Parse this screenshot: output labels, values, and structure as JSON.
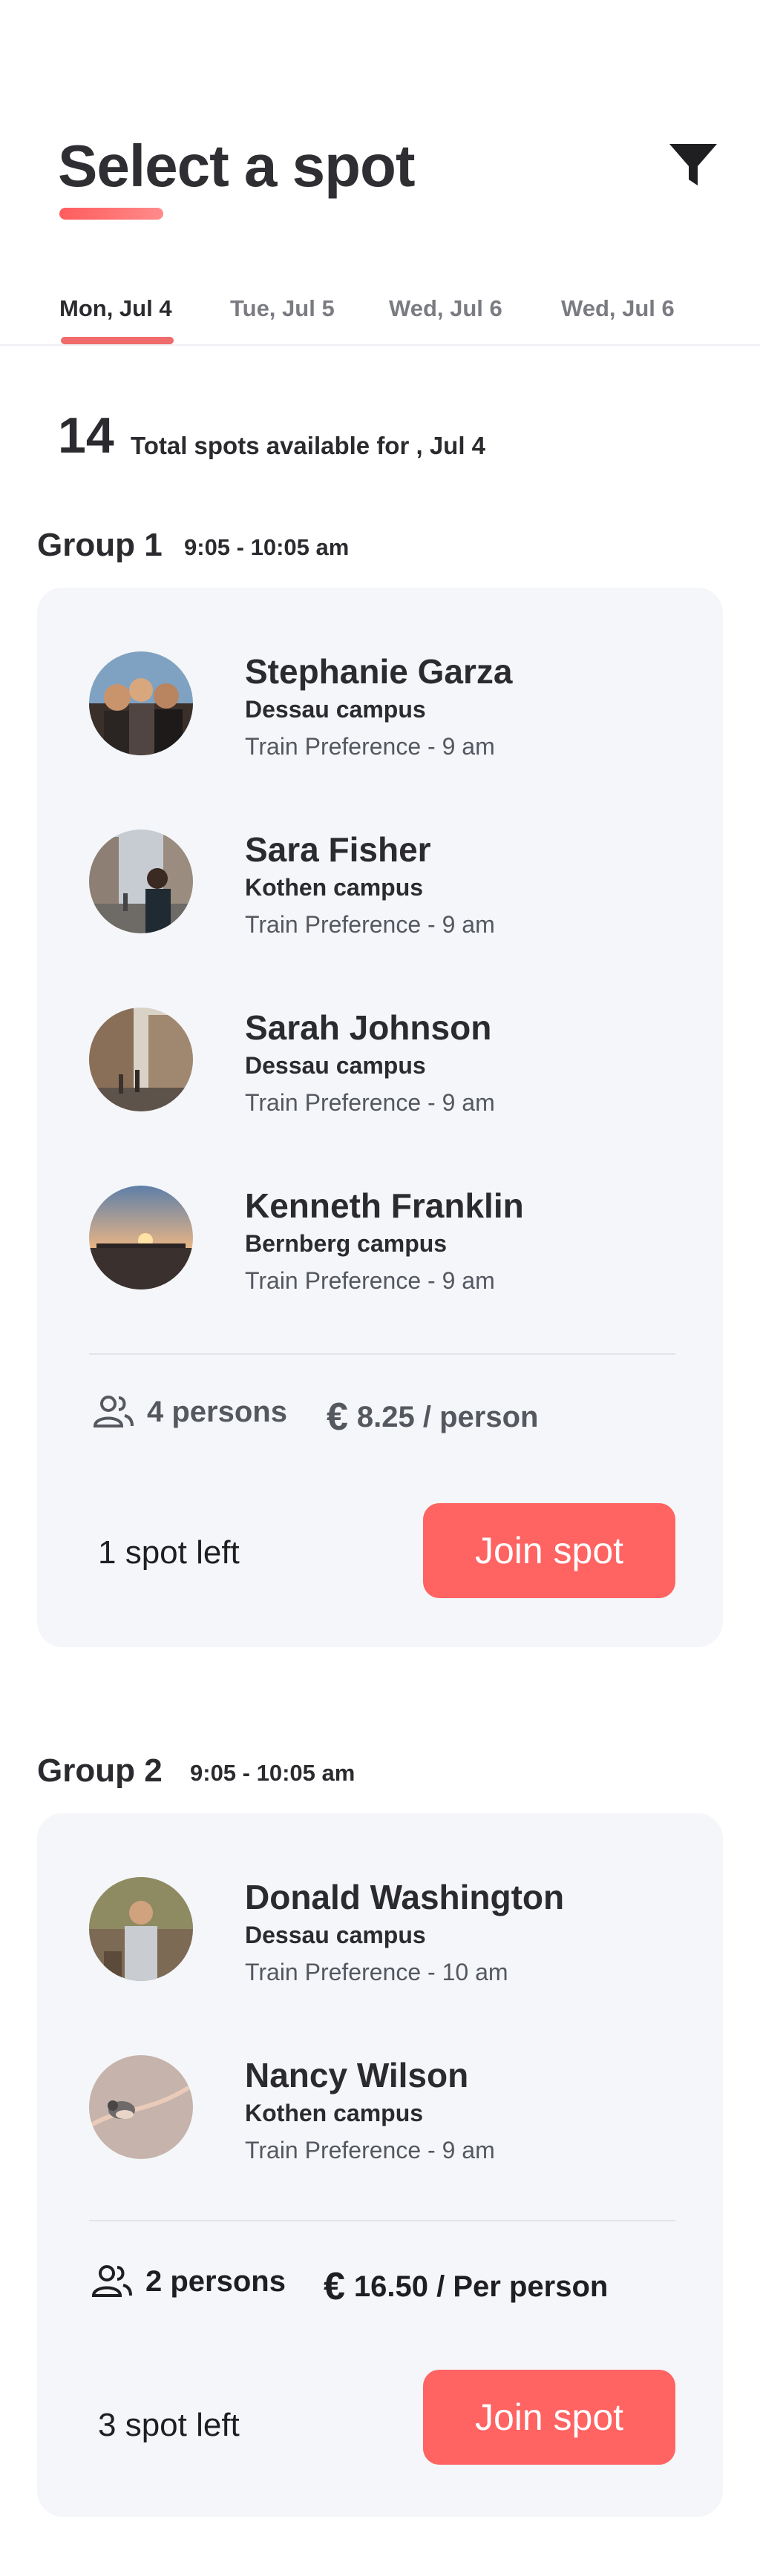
{
  "header": {
    "title": "Select a spot",
    "filter_icon": "filter-funnel-icon",
    "accent_color": "#ff6362"
  },
  "tabs": [
    {
      "label": "Mon, Jul 4",
      "active": true
    },
    {
      "label": "Tue, Jul 5",
      "active": false
    },
    {
      "label": "Wed, Jul 6",
      "active": false
    },
    {
      "label": "Wed, Jul 6",
      "active": false
    }
  ],
  "summary": {
    "total": "14",
    "label": "Total spots available for , Jul 4"
  },
  "groups": [
    {
      "title": "Group 1",
      "time": "9:05 - 10:05 am",
      "members": [
        {
          "name": "Stephanie Garza",
          "campus": "Dessau campus",
          "preference": "Train Preference - 9 am"
        },
        {
          "name": "Sara Fisher",
          "campus": "Kothen campus",
          "preference": "Train Preference - 9 am"
        },
        {
          "name": "Sarah Johnson",
          "campus": "Dessau campus",
          "preference": "Train Preference - 9 am"
        },
        {
          "name": "Kenneth Franklin",
          "campus": "Bernberg campus",
          "preference": "Train Preference - 9 am"
        }
      ],
      "persons": "4 persons",
      "price": "8.25 / person",
      "spots_left": "1 spot left",
      "join_label": "Join spot"
    },
    {
      "title": "Group 2",
      "time": "9:05 - 10:05 am",
      "members": [
        {
          "name": "Donald Washington",
          "campus": "Dessau campus",
          "preference": "Train Preference - 10 am"
        },
        {
          "name": "Nancy Wilson",
          "campus": "Kothen campus",
          "preference": "Train Preference - 9 am"
        }
      ],
      "persons": "2 persons",
      "price": "16.50 / Per person",
      "spots_left": "3 spot left",
      "join_label": "Join spot"
    }
  ]
}
